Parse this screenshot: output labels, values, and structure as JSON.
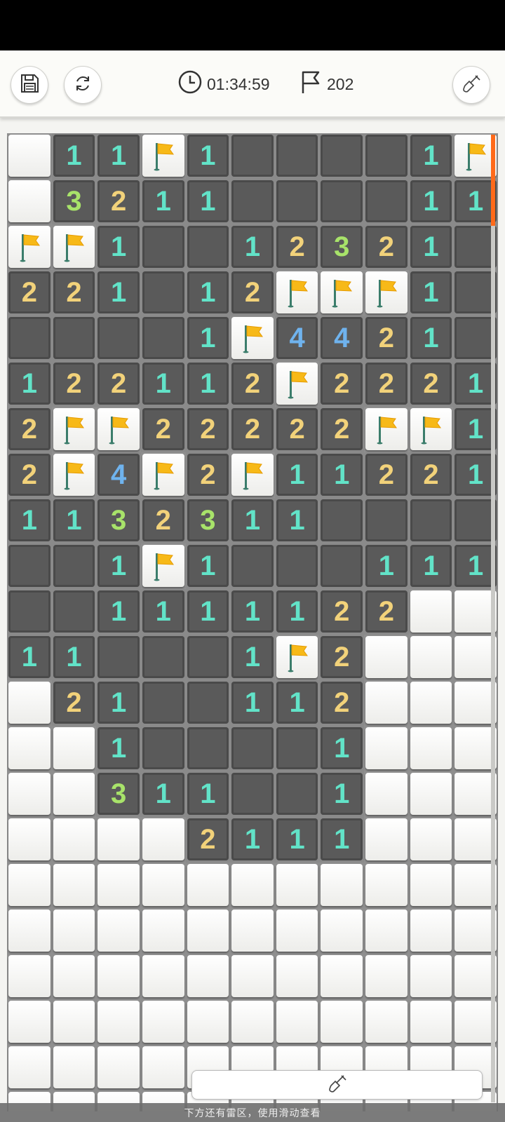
{
  "toolbar": {
    "timer": "01:34:59",
    "flags_remaining": "202",
    "save_icon": "save-icon",
    "restart_icon": "restart-icon",
    "dig_mode_icon": "shovel-icon"
  },
  "board": {
    "columns": 11,
    "legend": "h = unopened tile, f = flagged tile, 0 = opened empty, 1-8 = opened number",
    "rows": [
      [
        "h",
        "1",
        "1",
        "f",
        "1",
        "0",
        "0",
        "0",
        "0",
        "1",
        "f"
      ],
      [
        "h",
        "3",
        "2",
        "1",
        "1",
        "0",
        "0",
        "0",
        "0",
        "1",
        "1"
      ],
      [
        "f",
        "f",
        "1",
        "0",
        "0",
        "1",
        "2",
        "3",
        "2",
        "1",
        "0"
      ],
      [
        "2",
        "2",
        "1",
        "0",
        "1",
        "2",
        "f",
        "f",
        "f",
        "1",
        "0"
      ],
      [
        "0",
        "0",
        "0",
        "0",
        "1",
        "f",
        "4",
        "4",
        "2",
        "1",
        "0"
      ],
      [
        "1",
        "2",
        "2",
        "1",
        "1",
        "2",
        "f",
        "2",
        "2",
        "2",
        "1"
      ],
      [
        "2",
        "f",
        "f",
        "2",
        "2",
        "2",
        "2",
        "2",
        "f",
        "f",
        "1"
      ],
      [
        "2",
        "f",
        "4",
        "f",
        "2",
        "f",
        "1",
        "1",
        "2",
        "2",
        "1"
      ],
      [
        "1",
        "1",
        "3",
        "2",
        "3",
        "1",
        "1",
        "0",
        "0",
        "0",
        "0"
      ],
      [
        "0",
        "0",
        "1",
        "f",
        "1",
        "0",
        "0",
        "0",
        "1",
        "1",
        "1"
      ],
      [
        "0",
        "0",
        "1",
        "1",
        "1",
        "1",
        "1",
        "2",
        "2",
        "h",
        "h"
      ],
      [
        "1",
        "1",
        "0",
        "0",
        "0",
        "1",
        "f",
        "2",
        "h",
        "h",
        "h"
      ],
      [
        "h",
        "2",
        "1",
        "0",
        "0",
        "1",
        "1",
        "2",
        "h",
        "h",
        "h"
      ],
      [
        "h",
        "h",
        "1",
        "0",
        "0",
        "0",
        "0",
        "1",
        "h",
        "h",
        "h"
      ],
      [
        "h",
        "h",
        "3",
        "1",
        "1",
        "0",
        "0",
        "1",
        "h",
        "h",
        "h"
      ],
      [
        "h",
        "h",
        "h",
        "h",
        "2",
        "1",
        "1",
        "1",
        "h",
        "h",
        "h"
      ],
      [
        "h",
        "h",
        "h",
        "h",
        "h",
        "h",
        "h",
        "h",
        "h",
        "h",
        "h"
      ],
      [
        "h",
        "h",
        "h",
        "h",
        "h",
        "h",
        "h",
        "h",
        "h",
        "h",
        "h"
      ],
      [
        "h",
        "h",
        "h",
        "h",
        "h",
        "h",
        "h",
        "h",
        "h",
        "h",
        "h"
      ],
      [
        "h",
        "h",
        "h",
        "h",
        "h",
        "h",
        "h",
        "h",
        "h",
        "h",
        "h"
      ],
      [
        "h",
        "h",
        "h",
        "h",
        "h",
        "h",
        "h",
        "h",
        "h",
        "h",
        "h"
      ],
      [
        "h",
        "h",
        "h",
        "h",
        "h",
        "h",
        "h",
        "h",
        "h",
        "h",
        "h"
      ]
    ]
  },
  "footer": {
    "hint": "下方还有雷区，使用滑动查看"
  }
}
